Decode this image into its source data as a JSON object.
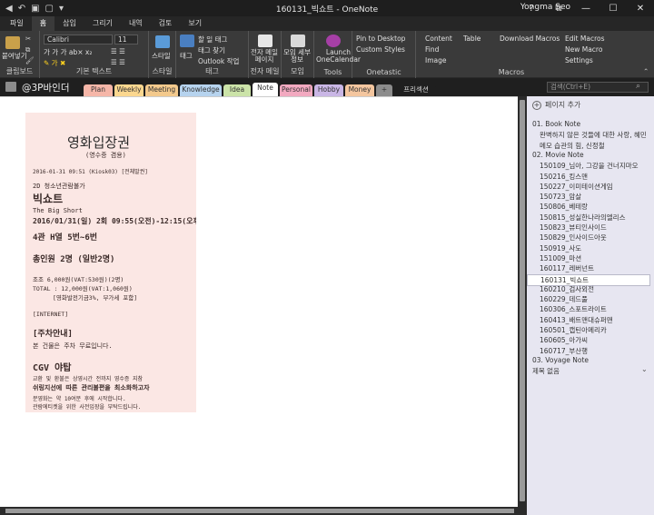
{
  "window": {
    "title": "160131_빅쇼트 - OneNote",
    "user": "Yongma Seo",
    "controls": [
      "?",
      "⧉",
      "—",
      "☐",
      "✕"
    ]
  },
  "tabs": [
    "파일",
    "홈",
    "삽입",
    "그리기",
    "내역",
    "검토",
    "보기"
  ],
  "ribbon": {
    "clipboard": {
      "paste_label": "붙여넣기",
      "group": "클립보드"
    },
    "text": {
      "font": "Calibri",
      "size": "11",
      "group": "기본 텍스트"
    },
    "styles": {
      "label": "스타일",
      "group": "스타일"
    },
    "tags": {
      "tag_label": "태그",
      "items": [
        "할 일 태그",
        "태그 찾기",
        "Outlook 작업"
      ],
      "group": "태그"
    },
    "email": {
      "label": "전자 메일\n페이지",
      "group": "전자 메일"
    },
    "meeting": {
      "label": "모임 세부\n정보",
      "group": "모임"
    },
    "tools": {
      "label": "Launch\nOneCalendar",
      "group": "Tools"
    },
    "onetastic": {
      "items": [
        "Pin to Desktop",
        "Custom Styles"
      ],
      "group": "Onetastic"
    },
    "macros": {
      "items": [
        "Content",
        "Table",
        "Find",
        "Image",
        "Download Macros",
        "Edit Macros",
        "New Macro",
        "Settings"
      ],
      "group": "Macros"
    }
  },
  "notebook": {
    "name": "@3P바인더",
    "sections": [
      "Plan",
      "Weekly",
      "Meeting",
      "Knowledge",
      "Idea",
      "Note",
      "Personal",
      "Hobby",
      "Money",
      "+",
      "프리섹션"
    ],
    "section_colors": [
      "#f5b6a8",
      "#fbd78f",
      "#f3c98c",
      "#b6d3ee",
      "#cbe3a8",
      "#ffffff",
      "#f2a9c0",
      "#c9b6e5",
      "#f4c69f",
      "#8c8c8c",
      "#1f1f1f"
    ],
    "search_placeholder": "검색(Ctrl+E)"
  },
  "receipt": {
    "lines": [
      "영화입장권",
      "(영수증 겸용)",
      "2016-01-31 09:51 (Kiosk03)      [전체발권]",
      "2D 청소년관람불가",
      "빅쇼트",
      "The Big Short",
      "2016/01/31(일) 2회 09:55(오전)-12:15(오후)",
      "4관 H열 5번~6번",
      "총인원 2명 (일반2명)",
      "조조 6,000원(VAT:530원)(2명)",
      "TOTAL  : 12,000원(VAT:1,060원)",
      "[영화발전기금3%, 부가세 포함]",
      "[INTERNET]",
      "[주차안내]",
      "본 건물은 주차 무료입니다.",
      "CGV 야탑",
      "교환 및 환불은 상영시간 전까지 영수증 지참",
      "쉬링지선에 따른 관리불편을 최소화하고자",
      "분영화는 약 10여분 후에 시작합니다.",
      "관람에티켓을 위한 사전입장을 부탁드립니다."
    ]
  },
  "pages_pane": {
    "add_page": "페이지 추가",
    "items": [
      {
        "text": "01. Book Note",
        "level": 0
      },
      {
        "text": "완벽하지 않은 것들에 대한 사랑, 혜민",
        "level": 1
      },
      {
        "text": "메모 습관의 힘, 신정철",
        "level": 1
      },
      {
        "text": "02. Movie Note",
        "level": 0
      },
      {
        "text": "150109_님아, 그강을 건너지마오",
        "level": 1
      },
      {
        "text": "150216_킹스맨",
        "level": 1
      },
      {
        "text": "150227_이미테이션게임",
        "level": 1
      },
      {
        "text": "150723_암살",
        "level": 1
      },
      {
        "text": "150806_베테랑",
        "level": 1
      },
      {
        "text": "150815_성실한나라의엘리스",
        "level": 1
      },
      {
        "text": "150823_뷰티인사이드",
        "level": 1
      },
      {
        "text": "150829_인사이드아웃",
        "level": 1
      },
      {
        "text": "150919_사도",
        "level": 1
      },
      {
        "text": "151009_마션",
        "level": 1
      },
      {
        "text": "160117_레버넌트",
        "level": 1
      },
      {
        "text": "160131_빅쇼트",
        "level": 1,
        "selected": true
      },
      {
        "text": "160210_검사외전",
        "level": 1
      },
      {
        "text": "160229_데드풀",
        "level": 1
      },
      {
        "text": "160306_스포트라이트",
        "level": 1
      },
      {
        "text": "160413_배트맨대슈퍼맨",
        "level": 1
      },
      {
        "text": "160501_캡틴아메리카",
        "level": 1
      },
      {
        "text": "160605_아가씨",
        "level": 1
      },
      {
        "text": "160717_부산행",
        "level": 1
      },
      {
        "text": "03. Voyage Note",
        "level": 0
      },
      {
        "text": "제목 없음",
        "level": 0
      }
    ]
  }
}
